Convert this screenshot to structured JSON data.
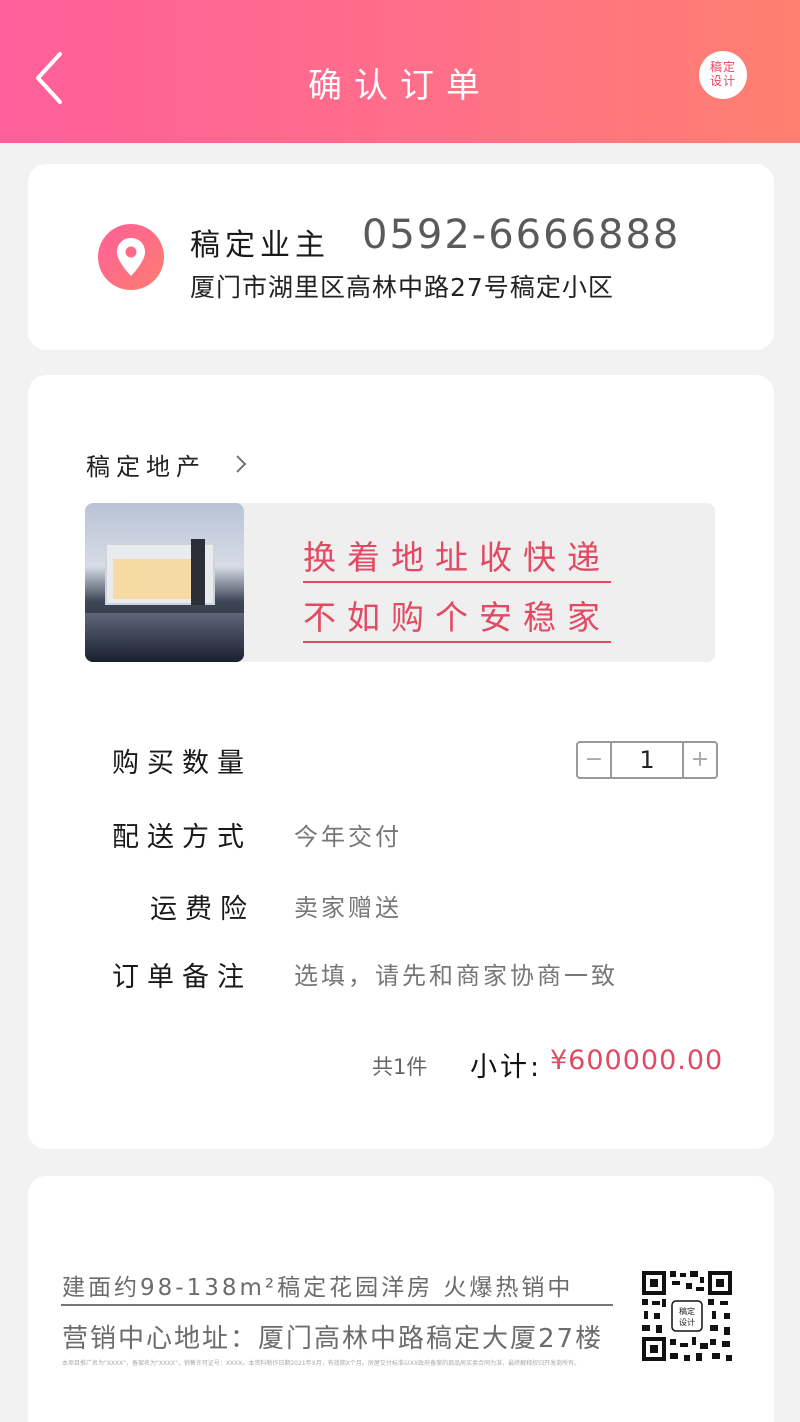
{
  "header": {
    "title": "确认订单",
    "logo_line1": "稿定",
    "logo_line2": "设计"
  },
  "address": {
    "name": "稿定业主",
    "phone": "0592-6666888",
    "detail": "厦门市湖里区高林中路27号稿定小区",
    "icon": "location-pin-icon"
  },
  "order": {
    "shop_name": "稿定地产",
    "product_slogan_line1": "换着地址收快递",
    "product_slogan_line2": "不如购个安稳家",
    "quantity_label": "购买数量",
    "quantity_value": "1",
    "quantity_minus": "−",
    "quantity_plus": "+",
    "delivery_label": "配送方式",
    "delivery_value": "今年交付",
    "insurance_label": "运费险",
    "insurance_value": "卖家赠送",
    "note_label": "订单备注",
    "note_placeholder": "选填，请先和商家协商一致",
    "count_text": "共1件",
    "subtotal_label": "小计:",
    "subtotal_value": "¥600000.00"
  },
  "footer": {
    "line1": "建面约98-138m²稿定花园洋房 火爆热销中",
    "line2": "营销中心地址：厦门高林中路稿定大厦27楼",
    "disclaimer": "本项目推广名为\"XXXX\"，备案名为\"XXXX\"，销售许可证号：XXXX。本资料制作日期2021年X月，有效期X个月。房屋交付标准以XX政府备案的商品房买卖合同为准，最终解释权归开发商所有。",
    "qr_label_line1": "稿定",
    "qr_label_line2": "设计"
  },
  "colors": {
    "accent": "#e24a63",
    "header_gradient_start": "#ff5f9a",
    "header_gradient_end": "#fe8070",
    "background": "#f2f2f2"
  }
}
